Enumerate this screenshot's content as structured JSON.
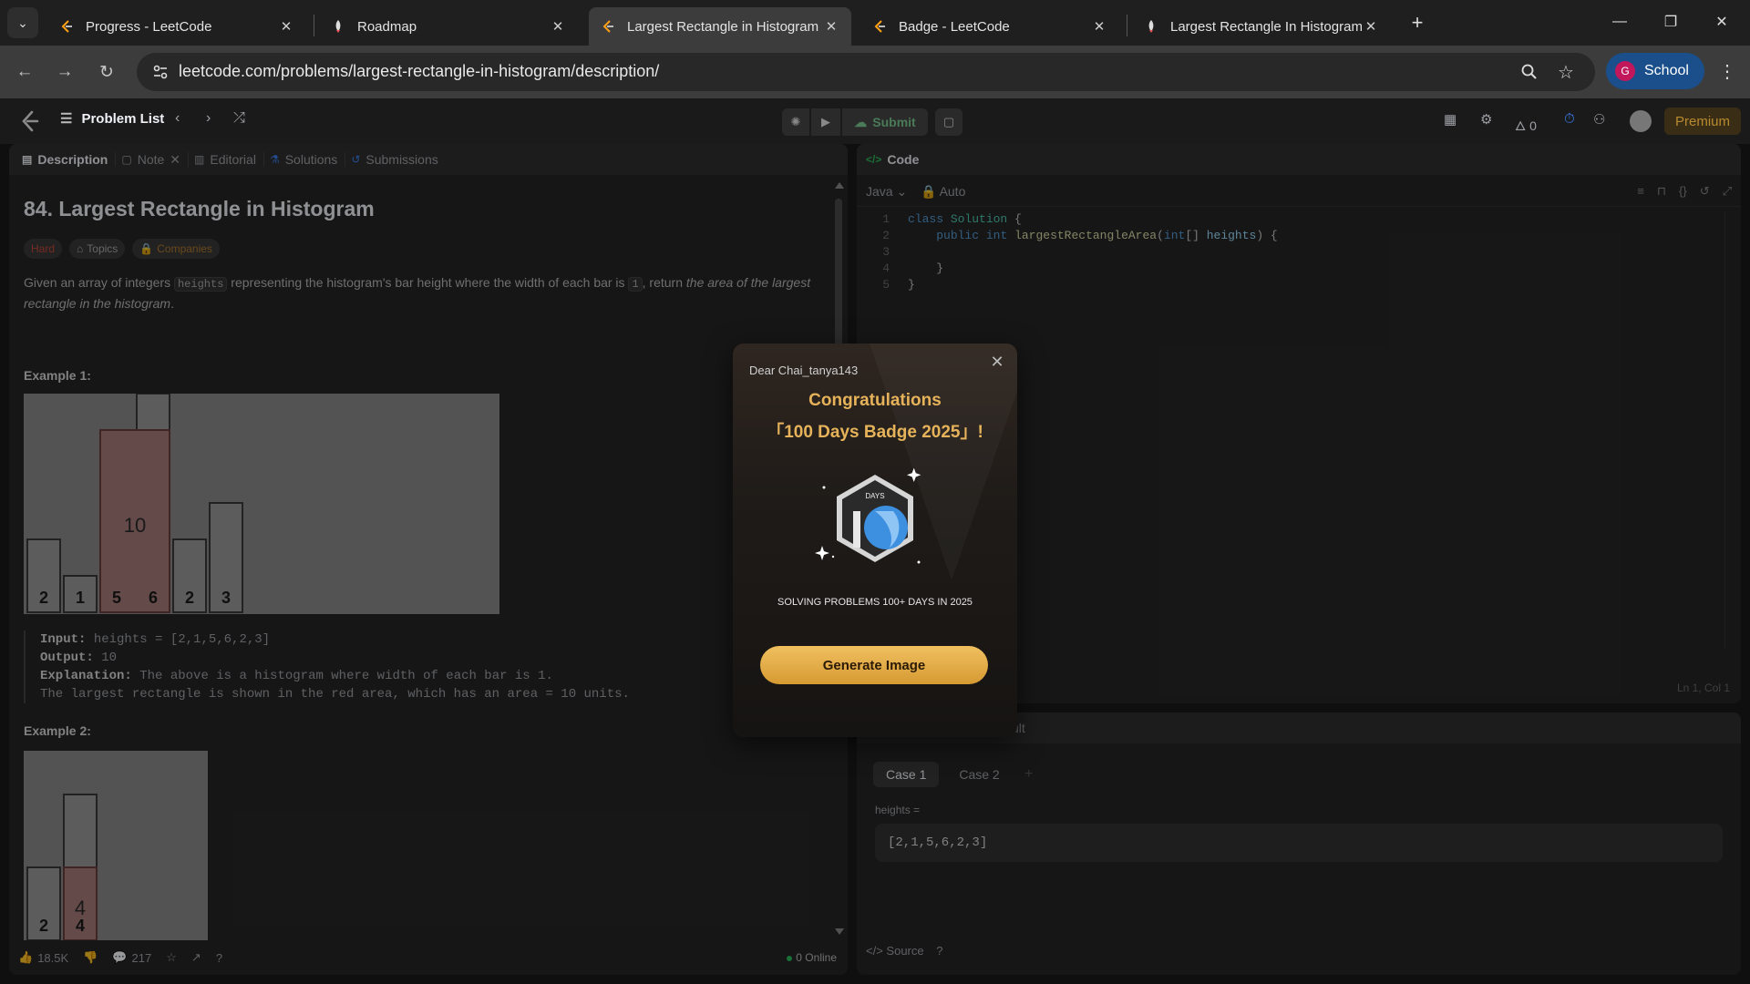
{
  "browser": {
    "tabs": [
      {
        "title": "Progress - LeetCode"
      },
      {
        "title": "Roadmap"
      },
      {
        "title": "Largest Rectangle in Histogram"
      },
      {
        "title": "Badge - LeetCode"
      },
      {
        "title": "Largest Rectangle In Histogram"
      }
    ],
    "active_tab": 2,
    "url": "leetcode.com/problems/largest-rectangle-in-histogram/description/",
    "profile": {
      "initial": "G",
      "name": "School"
    }
  },
  "header": {
    "problem_list": "Problem List",
    "submit": "Submit",
    "streak": "0",
    "premium": "Premium"
  },
  "left": {
    "tabs": [
      "Description",
      "Note",
      "Editorial",
      "Solutions",
      "Submissions"
    ],
    "title": "84. Largest Rectangle in Histogram",
    "difficulty": "Hard",
    "topics": "Topics",
    "companies": "Companies",
    "desc_1": "Given an array of integers",
    "desc_code1": "heights",
    "desc_2": "representing the histogram's bar height where the width of each bar is",
    "desc_code2": "1",
    "desc_3": ", return",
    "desc_italic": "the area of the largest rectangle in the histogram",
    "desc_4": ".",
    "example1_label": "Example 1:",
    "example1": {
      "input_label": "Input:",
      "input": "heights = [2,1,5,6,2,3]",
      "output_label": "Output:",
      "output": "10",
      "explanation_label": "Explanation:",
      "explanation_1": "The above is a histogram where width of each bar is 1.",
      "explanation_2": "The largest rectangle is shown in the red area, which has an area = 10 units."
    },
    "example2_label": "Example 2:",
    "histogram1": {
      "heights": [
        2,
        1,
        5,
        6,
        2,
        3
      ],
      "highlight_value": 10
    },
    "histogram2": {
      "heights": [
        2,
        4
      ],
      "highlight_value": 4
    },
    "footer": {
      "likes": "18.5K",
      "comments": "217",
      "online": "0 Online"
    }
  },
  "code": {
    "panel_title": "Code",
    "language": "Java",
    "auto": "Auto",
    "lines": [
      {
        "n": "1",
        "html": "<span class=\"kw\">class</span> <span class=\"cls\">Solution</span> {"
      },
      {
        "n": "2",
        "html": "    <span class=\"kw\">public</span> <span class=\"kw\">int</span> <span class=\"fn\">largestRectangleArea</span>(<span class=\"kw\">int</span>[] <span class=\"var\">heights</span>) {"
      },
      {
        "n": "3",
        "html": ""
      },
      {
        "n": "4",
        "html": "    }"
      },
      {
        "n": "5",
        "html": "}"
      }
    ],
    "cursor": "Ln 1, Col 1"
  },
  "testcase": {
    "head_partial": "ult",
    "cases": [
      "Case 1",
      "Case 2"
    ],
    "param_label": "heights =",
    "param_value": "[2,1,5,6,2,3]",
    "source": "Source"
  },
  "modal": {
    "dear": "Dear Chai_tanya143",
    "congrats": "Congratulations",
    "badge_name": "「100 Days Badge 2025」!",
    "art_text": "DAYS",
    "caption": "SOLVING PROBLEMS 100+ DAYS IN 2025",
    "button": "Generate Image"
  },
  "colors": {
    "accent": "#e6b35a",
    "hard": "#c4483a",
    "highlight": "#a87c7c"
  }
}
